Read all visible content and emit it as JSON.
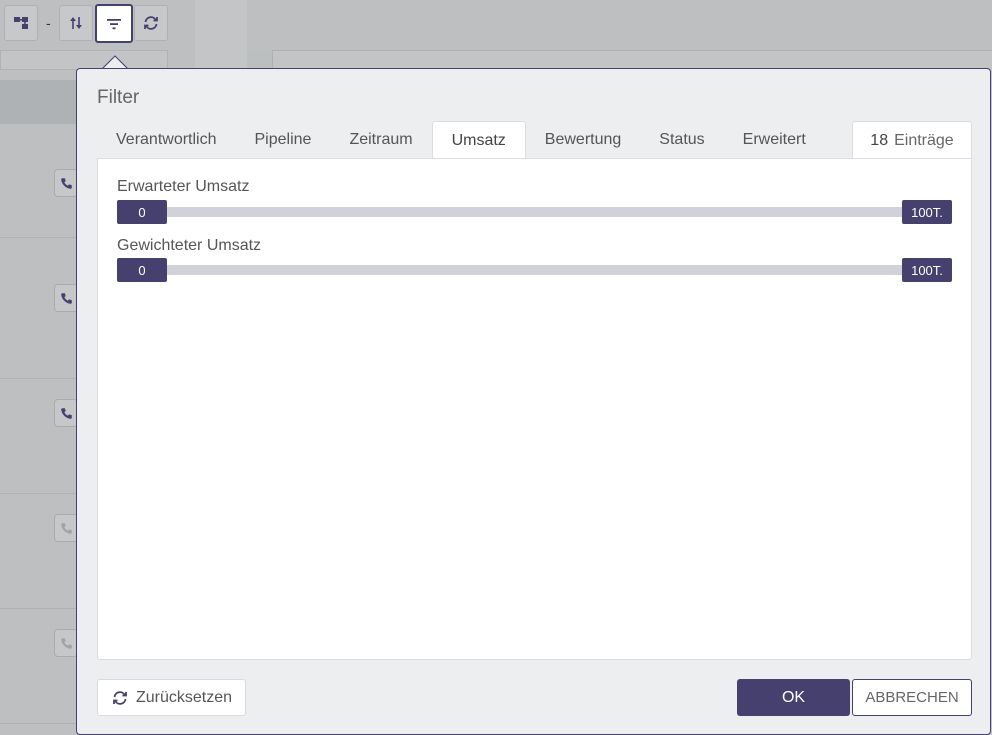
{
  "toolbar": {
    "separator": "-",
    "buttons": [
      "hierarchy-icon",
      "sort-icon",
      "filter-icon",
      "refresh-icon"
    ]
  },
  "dialog": {
    "title": "Filter",
    "tabs": [
      {
        "label": "Verantwortlich"
      },
      {
        "label": "Pipeline"
      },
      {
        "label": "Zeitraum"
      },
      {
        "label": "Umsatz"
      },
      {
        "label": "Bewertung"
      },
      {
        "label": "Status"
      },
      {
        "label": "Erweitert"
      }
    ],
    "active_tab": "Umsatz",
    "entry_count": "18",
    "entry_label": "Einträge",
    "ranges": [
      {
        "label": "Erwarteter Umsatz",
        "min": "0",
        "max": "100T."
      },
      {
        "label": "Gewichteter Umsatz",
        "min": "0",
        "max": "100T."
      }
    ],
    "reset_label": "Zurücksetzen",
    "ok_label": "OK",
    "cancel_label": "ABBRECHEN"
  },
  "colors": {
    "accent": "#45406e",
    "track": "#d1d1da",
    "dialog_bg": "#eceeef"
  }
}
